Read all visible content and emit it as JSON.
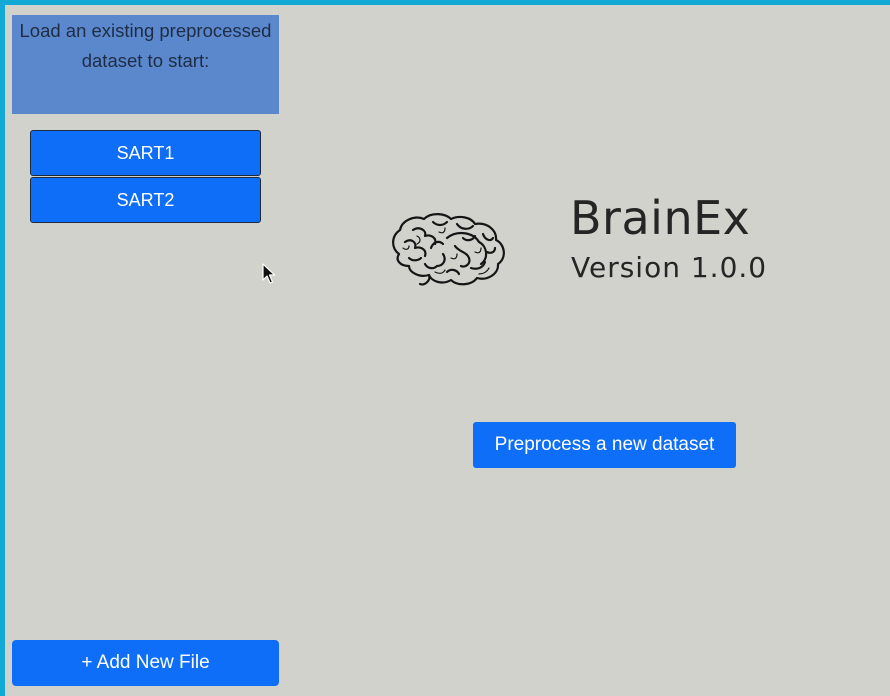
{
  "sidebar": {
    "header_text": "Load an existing preprocessed dataset to start:",
    "datasets": [
      {
        "label": "SART1"
      },
      {
        "label": "SART2"
      }
    ],
    "add_file_label": "+ Add New File"
  },
  "main": {
    "app_name": "BrainEx",
    "version_text": "Version 1.0.0",
    "preprocess_label": "Preprocess a new dataset"
  },
  "icons": {
    "logo": "brain-icon",
    "pointer": "mouse-cursor-icon"
  },
  "colors": {
    "window_border": "#12a9d6",
    "background": "#d2d2cd",
    "sidebar_header": "#5b88cc",
    "primary_button": "#0e6ef8",
    "title_text": "#252525"
  }
}
